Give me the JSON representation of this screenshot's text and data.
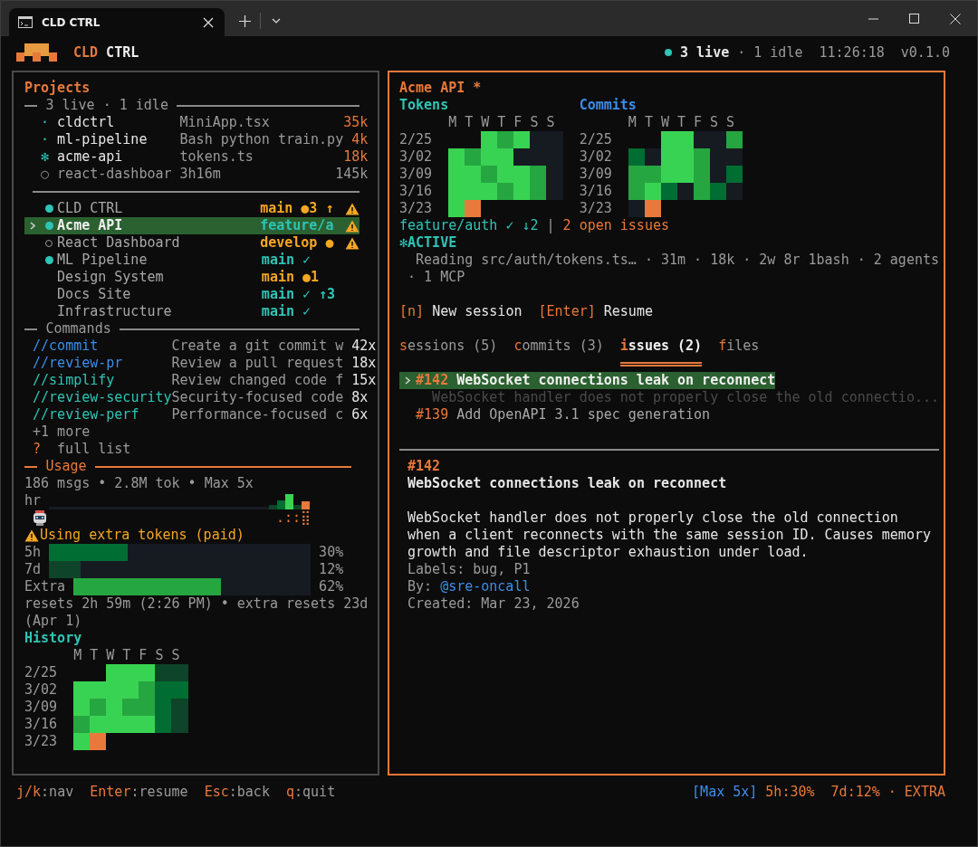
{
  "window": {
    "tab_title": "CLD CTRL"
  },
  "header": {
    "brand_a": "CLD",
    "brand_b": "CTRL",
    "live": "3 live",
    "idle": "· 1 idle",
    "time": "11:26:18",
    "version": "v0.1.0"
  },
  "projects_panel": {
    "title": "Projects",
    "live_divider": "3 live · 1 idle",
    "sessions": [
      {
        "marker": "·",
        "kind": "live",
        "name": "cldctrl",
        "file": "MiniApp.tsx",
        "tokens": "35k"
      },
      {
        "marker": "·",
        "kind": "live",
        "name": "ml-pipeline",
        "file": "Bash python train.py",
        "tokens": "4k"
      },
      {
        "marker": "✻",
        "kind": "live",
        "name": "acme-api",
        "file": "tokens.ts",
        "tokens": "18k"
      },
      {
        "marker": "○",
        "kind": "idle",
        "name": "react-dashboar",
        "file": "3h16m",
        "tokens": "145k"
      }
    ],
    "projects": [
      {
        "kind": "live",
        "name": "CLD CTRL",
        "branch": "main ●3 ↑",
        "clean": false,
        "warning": true,
        "selected": false
      },
      {
        "kind": "live",
        "name": "Acme API",
        "branch": "feature/a",
        "clean": true,
        "warning": true,
        "selected": true
      },
      {
        "kind": "idle",
        "name": "React Dashboard",
        "branch": "develop ●",
        "clean": false,
        "warning": true,
        "selected": false
      },
      {
        "kind": "live",
        "name": "ML Pipeline",
        "branch": "main ✓",
        "clean": true,
        "warning": false,
        "selected": false
      },
      {
        "kind": "plain",
        "name": "Design System",
        "branch": "main ●1",
        "clean": false,
        "warning": false,
        "selected": false
      },
      {
        "kind": "plain",
        "name": "Docs Site",
        "branch": "main ✓ ↑3",
        "clean": true,
        "warning": false,
        "selected": false
      },
      {
        "kind": "plain",
        "name": "Infrastructure",
        "branch": "main ✓",
        "clean": true,
        "warning": false,
        "selected": false
      }
    ],
    "commands_title": "Commands",
    "commands": [
      {
        "kind": "builtin",
        "name": "//commit",
        "description": "Create a git commit w",
        "count": "42x"
      },
      {
        "kind": "builtin",
        "name": "//review-pr",
        "description": "Review a pull request",
        "count": "18x"
      },
      {
        "kind": "custom",
        "name": "//simplify",
        "description": "Review changed code f",
        "count": "15x"
      },
      {
        "kind": "custom",
        "name": "//review-security",
        "description": "Security-focused code",
        "count": "8x"
      },
      {
        "kind": "custom",
        "name": "//review-perf",
        "description": "Performance-focused c",
        "count": "6x"
      }
    ],
    "more": "+1 more",
    "help_key": "?",
    "help_label": "full list"
  },
  "usage": {
    "title": "Usage",
    "summary": "186 msgs • 2.8M tok • Max 5x",
    "hour_label": "hr",
    "hour_marks": ".::⣿",
    "warning": "Using extra tokens (paid)",
    "limits": [
      {
        "label": "5h",
        "level": 0.3,
        "reading": "30%",
        "color": "#006d32"
      },
      {
        "label": "7d",
        "level": 0.12,
        "reading": "12%",
        "color": "#0e4429"
      },
      {
        "label": "Extra",
        "level": 0.62,
        "reading": "62%",
        "color": "#26a641"
      }
    ],
    "resets": "resets 2h 59m (2:26 PM) • extra resets 23d (Apr 1)"
  },
  "history": {
    "title": "History",
    "days": [
      "M",
      "T",
      "W",
      "T",
      "F",
      "S",
      "S"
    ],
    "weeks": [
      {
        "label": "2/25",
        "cells": [
          {
            "kind": "blank"
          },
          {
            "kind": "blank"
          },
          {
            "kind": "day",
            "color": "#39d353"
          },
          {
            "kind": "day",
            "color": "#39d353"
          },
          {
            "kind": "day",
            "color": "#39d353"
          },
          {
            "kind": "day",
            "color": "#0e4429"
          },
          {
            "kind": "day",
            "color": "#0e4429"
          }
        ]
      },
      {
        "label": "3/02",
        "cells": [
          {
            "kind": "day",
            "color": "#39d353"
          },
          {
            "kind": "day",
            "color": "#39d353"
          },
          {
            "kind": "day",
            "color": "#39d353"
          },
          {
            "kind": "day",
            "color": "#39d353"
          },
          {
            "kind": "day",
            "color": "#26a641"
          },
          {
            "kind": "day",
            "color": "#006d32"
          },
          {
            "kind": "day",
            "color": "#006d32"
          }
        ]
      },
      {
        "label": "3/09",
        "cells": [
          {
            "kind": "day",
            "color": "#39d353"
          },
          {
            "kind": "day",
            "color": "#26a641"
          },
          {
            "kind": "day",
            "color": "#39d353"
          },
          {
            "kind": "day",
            "color": "#26a641"
          },
          {
            "kind": "day",
            "color": "#26a641"
          },
          {
            "kind": "day",
            "color": "#006d32"
          },
          {
            "kind": "day",
            "color": "#0e4429"
          }
        ]
      },
      {
        "label": "3/16",
        "cells": [
          {
            "kind": "day",
            "color": "#26a641"
          },
          {
            "kind": "day",
            "color": "#39d353"
          },
          {
            "kind": "day",
            "color": "#39d353"
          },
          {
            "kind": "day",
            "color": "#39d353"
          },
          {
            "kind": "day",
            "color": "#39d353"
          },
          {
            "kind": "day",
            "color": "#006d32"
          },
          {
            "kind": "day",
            "color": "#0e4429"
          }
        ]
      },
      {
        "label": "3/23",
        "cells": [
          {
            "kind": "day",
            "color": "#39d353"
          },
          {
            "kind": "day",
            "color": "#e8793a"
          },
          {
            "kind": "blank"
          },
          {
            "kind": "blank"
          },
          {
            "kind": "blank"
          },
          {
            "kind": "blank"
          },
          {
            "kind": "blank"
          }
        ]
      }
    ]
  },
  "detail": {
    "title": "Acme API *",
    "heatmaps": [
      {
        "title": "Tokens",
        "color": "#2ec4b6",
        "days": [
          "M",
          "T",
          "W",
          "T",
          "F",
          "S",
          "S"
        ],
        "weeks": [
          {
            "label": "2/25",
            "cells": [
              {
                "kind": "blank"
              },
              {
                "kind": "blank"
              },
              {
                "kind": "day",
                "color": "#39d353"
              },
              {
                "kind": "day",
                "color": "#26a641"
              },
              {
                "kind": "day",
                "color": "#39d353"
              },
              {
                "kind": "day",
                "color": "#161b22"
              },
              {
                "kind": "day",
                "color": "#161b22"
              }
            ]
          },
          {
            "label": "3/02",
            "cells": [
              {
                "kind": "day",
                "color": "#39d353"
              },
              {
                "kind": "day",
                "color": "#26a641"
              },
              {
                "kind": "day",
                "color": "#39d353"
              },
              {
                "kind": "day",
                "color": "#39d353"
              },
              {
                "kind": "day",
                "color": "#161b22"
              },
              {
                "kind": "day",
                "color": "#161b22"
              },
              {
                "kind": "day",
                "color": "#161b22"
              }
            ]
          },
          {
            "label": "3/09",
            "cells": [
              {
                "kind": "day",
                "color": "#39d353"
              },
              {
                "kind": "day",
                "color": "#39d353"
              },
              {
                "kind": "day",
                "color": "#26a641"
              },
              {
                "kind": "day",
                "color": "#39d353"
              },
              {
                "kind": "day",
                "color": "#39d353"
              },
              {
                "kind": "day",
                "color": "#26a641"
              },
              {
                "kind": "day",
                "color": "#161b22"
              }
            ]
          },
          {
            "label": "3/16",
            "cells": [
              {
                "kind": "day",
                "color": "#39d353"
              },
              {
                "kind": "day",
                "color": "#39d353"
              },
              {
                "kind": "day",
                "color": "#39d353"
              },
              {
                "kind": "day",
                "color": "#26a641"
              },
              {
                "kind": "day",
                "color": "#39d353"
              },
              {
                "kind": "day",
                "color": "#26a641"
              },
              {
                "kind": "day",
                "color": "#161b22"
              }
            ]
          },
          {
            "label": "3/23",
            "cells": [
              {
                "kind": "day",
                "color": "#39d353"
              },
              {
                "kind": "day",
                "color": "#e8793a"
              },
              {
                "kind": "blank"
              },
              {
                "kind": "blank"
              },
              {
                "kind": "blank"
              },
              {
                "kind": "blank"
              },
              {
                "kind": "blank"
              }
            ]
          }
        ]
      },
      {
        "title": "Commits",
        "color": "#3b8eea",
        "days": [
          "M",
          "T",
          "W",
          "T",
          "F",
          "S",
          "S"
        ],
        "weeks": [
          {
            "label": "2/25",
            "cells": [
              {
                "kind": "blank"
              },
              {
                "kind": "blank"
              },
              {
                "kind": "day",
                "color": "#39d353"
              },
              {
                "kind": "day",
                "color": "#39d353"
              },
              {
                "kind": "day",
                "color": "#161b22"
              },
              {
                "kind": "day",
                "color": "#161b22"
              },
              {
                "kind": "day",
                "color": "#26a641"
              }
            ]
          },
          {
            "label": "3/02",
            "cells": [
              {
                "kind": "day",
                "color": "#006d32"
              },
              {
                "kind": "day",
                "color": "#161b22"
              },
              {
                "kind": "day",
                "color": "#39d353"
              },
              {
                "kind": "day",
                "color": "#39d353"
              },
              {
                "kind": "day",
                "color": "#26a641"
              },
              {
                "kind": "day",
                "color": "#161b22"
              },
              {
                "kind": "day",
                "color": "#161b22"
              }
            ]
          },
          {
            "label": "3/09",
            "cells": [
              {
                "kind": "day",
                "color": "#26a641"
              },
              {
                "kind": "day",
                "color": "#26a641"
              },
              {
                "kind": "day",
                "color": "#39d353"
              },
              {
                "kind": "day",
                "color": "#39d353"
              },
              {
                "kind": "day",
                "color": "#26a641"
              },
              {
                "kind": "day",
                "color": "#161b22"
              },
              {
                "kind": "day",
                "color": "#006d32"
              }
            ]
          },
          {
            "label": "3/16",
            "cells": [
              {
                "kind": "day",
                "color": "#26a641"
              },
              {
                "kind": "day",
                "color": "#39d353"
              },
              {
                "kind": "day",
                "color": "#006d32"
              },
              {
                "kind": "day",
                "color": "#161b22"
              },
              {
                "kind": "day",
                "color": "#26a641"
              },
              {
                "kind": "day",
                "color": "#006d32"
              },
              {
                "kind": "day",
                "color": "#161b22"
              }
            ]
          },
          {
            "label": "3/23",
            "cells": [
              {
                "kind": "day",
                "color": "#161b22"
              },
              {
                "kind": "day",
                "color": "#e8793a"
              },
              {
                "kind": "blank"
              },
              {
                "kind": "blank"
              },
              {
                "kind": "blank"
              },
              {
                "kind": "blank"
              },
              {
                "kind": "blank"
              }
            ]
          }
        ]
      }
    ],
    "branch": "feature/auth ✓ ↓2",
    "separator": "|",
    "open_issues": "2 open issues",
    "activity_icon": "✻",
    "activity": "ACTIVE",
    "activity_line": "Reading src/auth/tokens.ts… · 31m · 18k · 2w 8r 1bash · 2 agents · 1 MCP",
    "actions": [
      {
        "key": "[n]",
        "label": "New session"
      },
      {
        "key": "[Enter]",
        "label": "Resume"
      }
    ],
    "tabs": [
      {
        "hotkey": "s",
        "rest": "essions (5)",
        "selected": false
      },
      {
        "hotkey": "c",
        "rest": "ommits (3)",
        "selected": false
      },
      {
        "hotkey": "i",
        "rest": "ssues (2)",
        "selected": true
      },
      {
        "hotkey": "f",
        "rest": "iles",
        "selected": false
      }
    ],
    "issues": [
      {
        "number": "#142",
        "title": "WebSocket connections leak on reconnect",
        "preview": "WebSocket handler does not properly close the old connectio...",
        "selected": true
      },
      {
        "number": "#139",
        "title": "Add OpenAPI 3.1 spec generation",
        "selected": false
      }
    ],
    "issue_detail": {
      "number": "#142",
      "title": "WebSocket connections leak on reconnect",
      "body": "WebSocket handler does not properly close the old connection when a client reconnects with the same session ID. Causes memory growth and file descriptor exhaustion under load.",
      "labels": "Labels: bug, P1",
      "by": "By:",
      "author": "@sre-oncall",
      "created": "Created: Mar 23, 2026"
    }
  },
  "footer": {
    "hints": [
      {
        "key": "j/k",
        "label": ":nav"
      },
      {
        "key": "Enter",
        "label": ":resume"
      },
      {
        "key": "Esc",
        "label": ":back"
      },
      {
        "key": "q",
        "label": ":quit"
      }
    ],
    "plan": "[Max 5x]",
    "five_hour": "5h:30%",
    "seven_day": "7d:12%",
    "extra": "· EXTRA"
  }
}
